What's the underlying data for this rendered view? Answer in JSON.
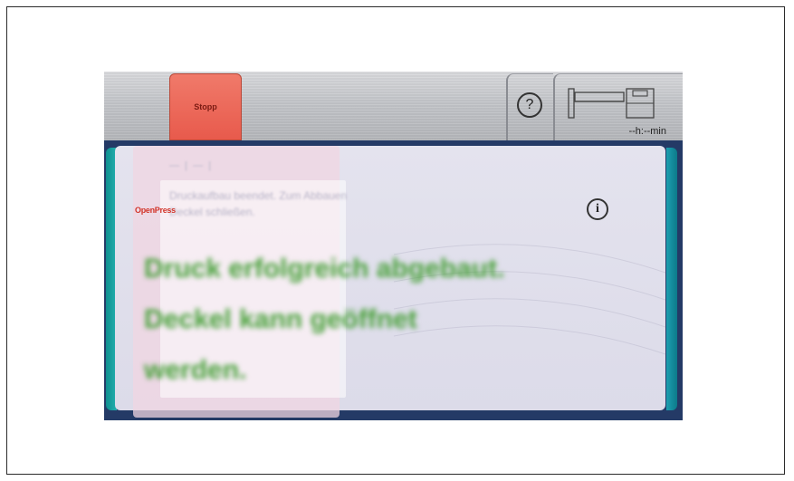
{
  "toolbar": {
    "stop_label": "Stopp",
    "help_icon": "help-icon",
    "time_remaining": "--h:--min"
  },
  "panel": {
    "logo_text": "OpenPress",
    "message": "Druck erfolgreich abgebaut. Deckel kann geöffnet werden.",
    "info_icon": "info-icon",
    "background_hint": "Druckaufbau beendet. Zum Abbauen Deckel schließen."
  },
  "colors": {
    "stop": "#e85a4c",
    "accent_teal": "#1d9fb0",
    "message_green": "#48a03a"
  }
}
